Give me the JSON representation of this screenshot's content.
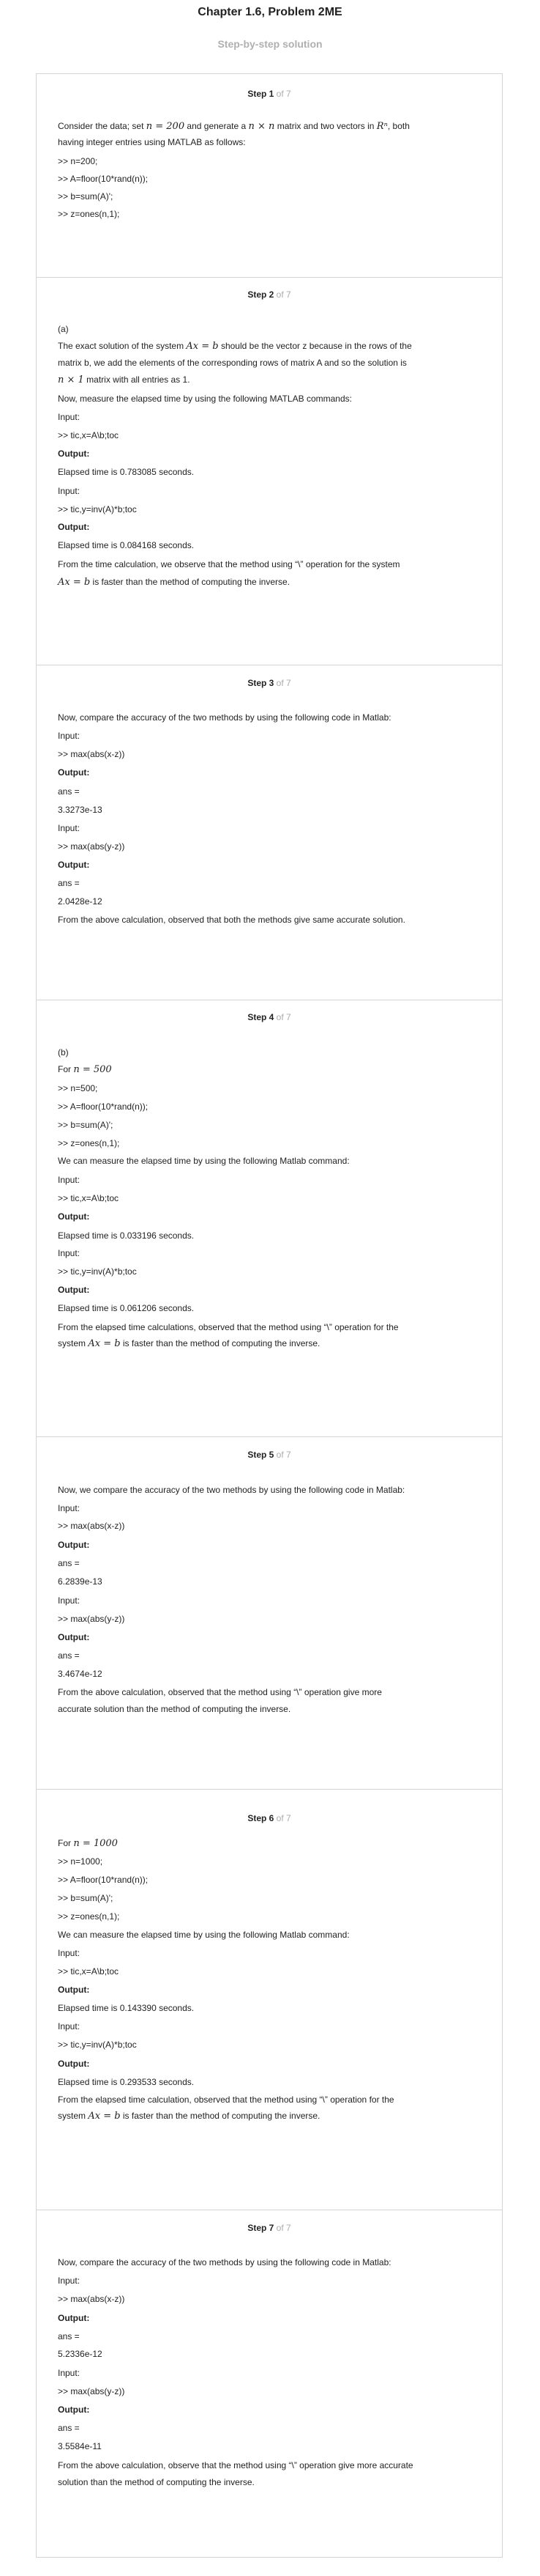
{
  "page": {
    "title": "Chapter 1.6, Problem 2ME",
    "subtitle": "Step-by-step solution",
    "of_total": "of 7"
  },
  "steps": [
    {
      "label": "Step 1",
      "lines": [
        [
          "Consider the data; set ",
          {
            "m": "n = 200"
          },
          " and generate a ",
          {
            "m": "n × n"
          },
          " matrix and two vectors in ",
          {
            "m": "Rⁿ"
          },
          ", both"
        ],
        [
          "having integer entries using MATLAB as follows:"
        ],
        [
          ">> n=200;"
        ],
        [
          ">> A=floor(10*rand(n));"
        ],
        [
          ">> b=sum(A)';"
        ],
        [
          ">> z=ones(n,1);"
        ]
      ]
    },
    {
      "label": "Step 2",
      "lines": [
        [
          "(a)"
        ],
        [
          "The exact solution of the system ",
          {
            "m": "Ax = b"
          },
          " should be the vector z because in the rows of the"
        ],
        [
          "matrix b, we add the elements of the corresponding rows of matrix A and so the solution is"
        ],
        [
          {
            "m": "n × 1"
          },
          " matrix with all entries as 1."
        ],
        [
          "Now, measure the elapsed time by using the following MATLAB commands:"
        ],
        [
          "Input:"
        ],
        [
          ">> tic,x=A\\b;toc"
        ],
        [
          {
            "b": "Output:"
          }
        ],
        [
          "Elapsed time is 0.783085 seconds."
        ],
        [
          "Input:"
        ],
        [
          ">> tic,y=inv(A)*b;toc"
        ],
        [
          {
            "b": "Output:"
          }
        ],
        [
          "Elapsed time is 0.084168 seconds."
        ],
        [
          "From the time calculation, we observe that the method using “\\” operation for the system"
        ],
        [
          {
            "m": "Ax = b"
          },
          " is faster than the method of computing the inverse."
        ]
      ]
    },
    {
      "label": "Step 3",
      "lines": [
        [
          "Now, compare the accuracy of the two methods by using the following code in Matlab:"
        ],
        [
          "Input:"
        ],
        [
          ">> max(abs(x-z))"
        ],
        [
          {
            "b": "Output:"
          }
        ],
        [
          "ans ="
        ],
        [
          "3.3273e-13"
        ],
        [
          "Input:"
        ],
        [
          ">> max(abs(y-z))"
        ],
        [
          {
            "b": "Output:"
          }
        ],
        [
          "ans ="
        ],
        [
          "2.0428e-12"
        ],
        [
          "From the above calculation, observed that both the methods give same accurate solution."
        ]
      ]
    },
    {
      "label": "Step 4",
      "lines": [
        [
          "(b)"
        ],
        [
          "For ",
          {
            "m": "n = 500"
          }
        ],
        [
          ">> n=500;"
        ],
        [
          ">> A=floor(10*rand(n));"
        ],
        [
          ">> b=sum(A)';"
        ],
        [
          ">> z=ones(n,1);"
        ],
        [
          "We can measure the elapsed time by using the following Matlab command:"
        ],
        [
          "Input:"
        ],
        [
          ">> tic,x=A\\b;toc"
        ],
        [
          {
            "b": "Output:"
          }
        ],
        [
          "Elapsed time is 0.033196 seconds."
        ],
        [
          "Input:"
        ],
        [
          ">> tic,y=inv(A)*b;toc"
        ],
        [
          {
            "b": "Output:"
          }
        ],
        [
          "Elapsed time is 0.061206 seconds."
        ],
        [
          "From the elapsed time calculations, observed that the method using “\\” operation for the"
        ],
        [
          "system ",
          {
            "m": "Ax = b"
          },
          " is faster than the method of computing the inverse."
        ]
      ]
    },
    {
      "label": "Step 5",
      "lines": [
        [
          "Now, we compare the accuracy of the two methods by using the following code in Matlab:"
        ],
        [
          "Input:"
        ],
        [
          ">> max(abs(x-z))"
        ],
        [
          {
            "b": "Output:"
          }
        ],
        [
          "ans ="
        ],
        [
          "6.2839e-13"
        ],
        [
          "Input:"
        ],
        [
          ">> max(abs(y-z))"
        ],
        [
          {
            "b": "Output:"
          }
        ],
        [
          "ans ="
        ],
        [
          "3.4674e-12"
        ],
        [
          "From the above calculation, observed that the method using “\\” operation give more"
        ],
        [
          "accurate solution than the method of computing the inverse."
        ]
      ]
    },
    {
      "label": "Step 6",
      "lines": [
        [
          "For ",
          {
            "m": "n = 1000"
          }
        ],
        [
          ">> n=1000;"
        ],
        [
          ">> A=floor(10*rand(n));"
        ],
        [
          ">> b=sum(A)';"
        ],
        [
          ">> z=ones(n,1);"
        ],
        [
          "We can measure the elapsed time by using the following Matlab command:"
        ],
        [
          "Input:"
        ],
        [
          ">> tic,x=A\\b;toc"
        ],
        [
          {
            "b": "Output:"
          }
        ],
        [
          "Elapsed time is 0.143390 seconds."
        ],
        [
          "Input:"
        ],
        [
          ">> tic,y=inv(A)*b;toc"
        ],
        [
          {
            "b": "Output:"
          }
        ],
        [
          "Elapsed time is 0.293533 seconds."
        ],
        [
          "From the elapsed time calculation, observed that the method using “\\” operation for the"
        ],
        [
          "system ",
          {
            "m": "Ax = b"
          },
          " is faster than the method of computing the inverse."
        ]
      ]
    },
    {
      "label": "Step 7",
      "lines": [
        [
          "Now, compare the accuracy of the two methods by using the following code in Matlab:"
        ],
        [
          "Input:"
        ],
        [
          ">> max(abs(x-z))"
        ],
        [
          {
            "b": "Output:"
          }
        ],
        [
          "ans ="
        ],
        [
          "5.2336e-12"
        ],
        [
          "Input:"
        ],
        [
          ">> max(abs(y-z))"
        ],
        [
          {
            "b": "Output:"
          }
        ],
        [
          "ans ="
        ],
        [
          "3.5584e-11"
        ],
        [
          "From the above calculation, observe that the method using “\\” operation give more accurate"
        ],
        [
          "solution than the method of computing the inverse."
        ]
      ]
    }
  ]
}
